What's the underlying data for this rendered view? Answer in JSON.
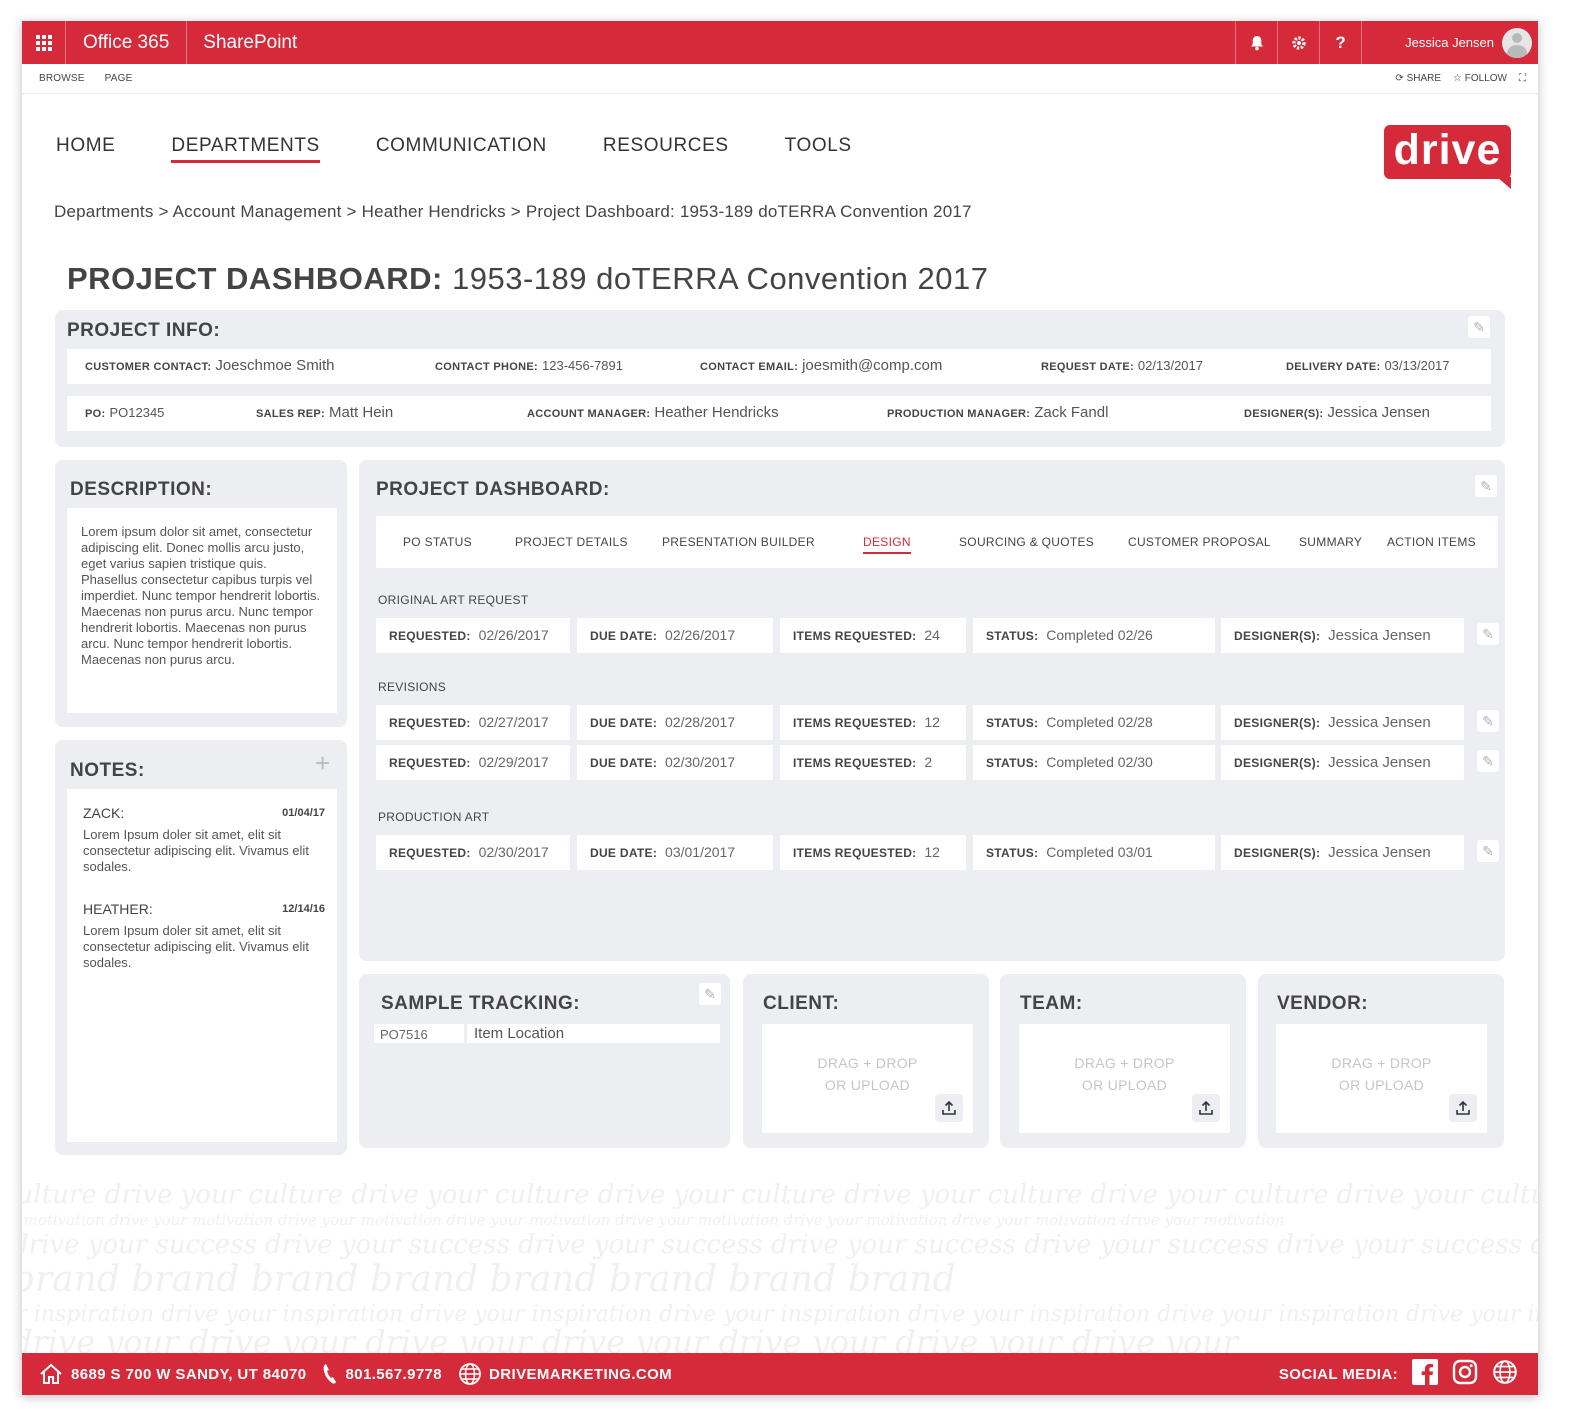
{
  "suite": {
    "app": "Office 365",
    "site": "SharePoint",
    "user": "Jessica Jensen",
    "help": "?"
  },
  "ribbon": {
    "browse": "BROWSE",
    "page": "PAGE",
    "share": "SHARE",
    "follow": "FOLLOW"
  },
  "nav": {
    "items": [
      "HOME",
      "DEPARTMENTS",
      "COMMUNICATION",
      "RESOURCES",
      "TOOLS"
    ],
    "active": "DEPARTMENTS"
  },
  "logo": "drive",
  "breadcrumb": {
    "items": [
      "Departments",
      "Account Management",
      "Heather Hendricks",
      "Project Dashboard: 1953-189 doTERRA Convention 2017"
    ],
    "sep": ">"
  },
  "title": {
    "bold": "PROJECT DASHBOARD:",
    "rest": "1953-189 doTERRA Convention 2017"
  },
  "project_info": {
    "title": "PROJECT INFO:",
    "customer_contact_label": "CUSTOMER CONTACT:",
    "customer_contact": "Joeschmoe Smith",
    "contact_phone_label": "CONTACT PHONE:",
    "contact_phone": "123-456-7891",
    "contact_email_label": "CONTACT EMAIL:",
    "contact_email": "joesmith@comp.com",
    "request_date_label": "REQUEST DATE:",
    "request_date": "02/13/2017",
    "delivery_date_label": "DELIVERY DATE:",
    "delivery_date": "03/13/2017",
    "po_label": "PO:",
    "po": "PO12345",
    "sales_rep_label": "SALES REP:",
    "sales_rep": "Matt Hein",
    "account_manager_label": "ACCOUNT MANAGER:",
    "account_manager": "Heather Hendricks",
    "production_manager_label": "PRODUCTION MANAGER:",
    "production_manager": "Zack Fandl",
    "designers_label": "DESIGNER(S):",
    "designers": "Jessica Jensen"
  },
  "description": {
    "title": "DESCRIPTION:",
    "text": "Lorem ipsum dolor sit amet, consectetur adipiscing elit. Donec mollis arcu justo, eget varius sapien tristique quis. Phasellus consectetur capibus turpis vel imperdiet. Nunc tempor hendrerit lobortis. Maecenas non purus arcu. Nunc tempor hendrerit lobortis. Maecenas non purus arcu. Nunc tempor hendrerit lobortis. Maecenas non purus arcu."
  },
  "notes": {
    "title": "NOTES:",
    "items": [
      {
        "author": "ZACK:",
        "date": "01/04/17",
        "text": "Lorem Ipsum doler sit amet, elit sit consectetur adipiscing elit. Vivamus elit sodales."
      },
      {
        "author": "HEATHER:",
        "date": "12/14/16",
        "text": "Lorem Ipsum doler sit amet, elit sit consectetur adipiscing elit. Vivamus elit sodales."
      }
    ]
  },
  "dashboard": {
    "title": "PROJECT DASHBOARD:",
    "tabs": [
      "PO STATUS",
      "PROJECT DETAILS",
      "PRESENTATION BUILDER",
      "DESIGN",
      "SOURCING & QUOTES",
      "CUSTOMER PROPOSAL",
      "SUMMARY",
      "ACTION ITEMS"
    ],
    "active_tab": "DESIGN",
    "labels": {
      "requested": "REQUESTED:",
      "due_date": "DUE DATE:",
      "items_requested": "ITEMS REQUESTED:",
      "status": "STATUS:",
      "designers": "DESIGNER(S):"
    },
    "sections": {
      "original": "ORIGINAL ART REQUEST",
      "revisions": "REVISIONS",
      "production": "PRODUCTION ART"
    },
    "rows": [
      {
        "requested": "02/26/2017",
        "due": "02/26/2017",
        "items": "24",
        "status": "Completed 02/26",
        "designer": "Jessica Jensen"
      },
      {
        "requested": "02/27/2017",
        "due": "02/28/2017",
        "items": "12",
        "status": "Completed 02/28",
        "designer": "Jessica Jensen"
      },
      {
        "requested": "02/29/2017",
        "due": "02/30/2017",
        "items": "2",
        "status": "Completed 02/30",
        "designer": "Jessica Jensen"
      },
      {
        "requested": "02/30/2017",
        "due": "03/01/2017",
        "items": "12",
        "status": "Completed 03/01",
        "designer": "Jessica Jensen"
      }
    ]
  },
  "sample_tracking": {
    "title": "SAMPLE TRACKING:",
    "po": "PO7516",
    "location": "Item Location"
  },
  "uploads": {
    "client": "CLIENT:",
    "team": "TEAM:",
    "vendor": "VENDOR:",
    "drop_line1": "DRAG + DROP",
    "drop_line2": "OR UPLOAD"
  },
  "footer": {
    "address": "8689 S 700 W SANDY, UT 84070",
    "phone": "801.567.9778",
    "web": "DRIVEMARKETING.COM",
    "social": "SOCIAL MEDIA:"
  },
  "colors": {
    "brand": "#d42a3a",
    "panel": "#eceef1"
  }
}
